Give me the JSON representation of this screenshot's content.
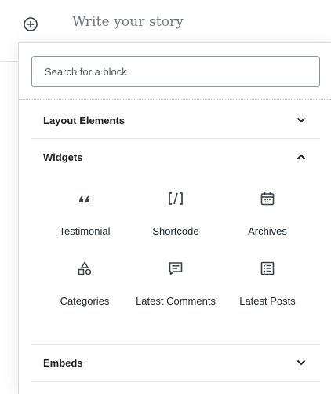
{
  "editor": {
    "story_placeholder": "Write your story"
  },
  "inserter": {
    "search_placeholder": "Search for a block",
    "panels": [
      {
        "title": "Layout Elements",
        "expanded": false
      },
      {
        "title": "Widgets",
        "expanded": true
      },
      {
        "title": "Embeds",
        "expanded": false
      }
    ],
    "widgets": [
      {
        "label": "Testimonial",
        "icon": "quote-icon"
      },
      {
        "label": "Shortcode",
        "icon": "shortcode-icon"
      },
      {
        "label": "Archives",
        "icon": "calendar-icon"
      },
      {
        "label": "Categories",
        "icon": "shapes-icon"
      },
      {
        "label": "Latest Comments",
        "icon": "comment-icon"
      },
      {
        "label": "Latest Posts",
        "icon": "list-icon"
      }
    ]
  },
  "colors": {
    "text": "#1e1e1e",
    "muted": "#6c7781",
    "border": "#e2e4e7"
  }
}
